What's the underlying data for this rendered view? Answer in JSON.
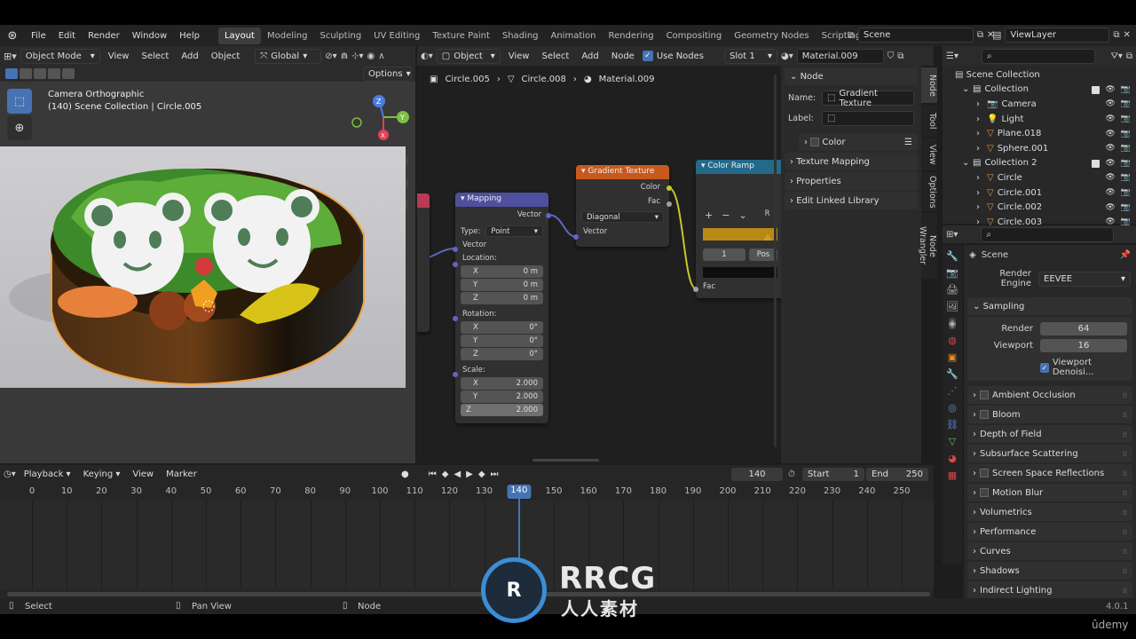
{
  "menubar": {
    "items": [
      "File",
      "Edit",
      "Render",
      "Window",
      "Help"
    ],
    "workspaces": [
      "Layout",
      "Modeling",
      "Sculpting",
      "UV Editing",
      "Texture Paint",
      "Shading",
      "Animation",
      "Rendering",
      "Compositing",
      "Geometry Nodes",
      "Scripting"
    ],
    "scene": "Scene",
    "view_layer": "ViewLayer"
  },
  "viewport": {
    "mode": "Object Mode",
    "menus": [
      "View",
      "Select",
      "Add",
      "Object"
    ],
    "orientation": "Global",
    "options": "Options",
    "cam_title": "Camera Orthographic",
    "cam_sub": "(140) Scene Collection | Circle.005"
  },
  "node_editor": {
    "type": "Object",
    "menus": [
      "View",
      "Select",
      "Add",
      "Node"
    ],
    "use_nodes": "Use Nodes",
    "slot": "Slot 1",
    "material": "Material.009",
    "breadcrumb": [
      "Circle.005",
      "Circle.008",
      "Material.009"
    ],
    "mapping": {
      "title": "Mapping",
      "out_vector": "Vector",
      "type_label": "Type:",
      "type_value": "Point",
      "in_vector": "Vector",
      "location": "Location:",
      "rotation": "Rotation:",
      "scale": "Scale:",
      "loc": [
        {
          "axis": "X",
          "val": "0 m"
        },
        {
          "axis": "Y",
          "val": "0 m"
        },
        {
          "axis": "Z",
          "val": "0 m"
        }
      ],
      "rot": [
        {
          "axis": "X",
          "val": "0°"
        },
        {
          "axis": "Y",
          "val": "0°"
        },
        {
          "axis": "Z",
          "val": "0°"
        }
      ],
      "scl": [
        {
          "axis": "X",
          "val": "2.000"
        },
        {
          "axis": "Y",
          "val": "2.000"
        },
        {
          "axis": "Z",
          "val": "2.000"
        }
      ]
    },
    "gradient": {
      "title": "Gradient Texture",
      "color": "Color",
      "fac": "Fac",
      "type": "Diagonal",
      "vector": "Vector"
    },
    "ramp": {
      "title": "Color Ramp",
      "index": "1",
      "pos": "Pos",
      "fac": "Fac",
      "r": "R"
    }
  },
  "sidebar": {
    "node": "Node",
    "name_label": "Name:",
    "name_value": "Gradient Texture",
    "label_label": "Label:",
    "color": "Color",
    "sections": [
      "Texture Mapping",
      "Properties",
      "Edit Linked Library"
    ],
    "tabs": [
      "Node",
      "Tool",
      "View",
      "Options",
      "Node Wrangler"
    ]
  },
  "outliner": {
    "root": "Scene Collection",
    "rows": [
      {
        "label": "Collection",
        "indent": 1
      },
      {
        "label": "Camera",
        "indent": 2
      },
      {
        "label": "Light",
        "indent": 2
      },
      {
        "label": "Plane.018",
        "indent": 2
      },
      {
        "label": "Sphere.001",
        "indent": 2
      },
      {
        "label": "Collection 2",
        "indent": 1
      },
      {
        "label": "Circle",
        "indent": 2
      },
      {
        "label": "Circle.001",
        "indent": 2
      },
      {
        "label": "Circle.002",
        "indent": 2
      },
      {
        "label": "Circle.003",
        "indent": 2
      }
    ]
  },
  "properties": {
    "scene": "Scene",
    "engine_label": "Render Engine",
    "engine": "EEVEE",
    "sampling": "Sampling",
    "render_label": "Render",
    "render_val": "64",
    "viewport_label": "Viewport",
    "viewport_val": "16",
    "denoise": "Viewport Denoisi...",
    "sections": [
      "Ambient Occlusion",
      "Bloom",
      "Depth of Field",
      "Subsurface Scattering",
      "Screen Space Reflections",
      "Motion Blur",
      "Volumetrics",
      "Performance",
      "Curves",
      "Shadows",
      "Indirect Lighting"
    ]
  },
  "timeline": {
    "menus": [
      "Playback",
      "Keying",
      "View",
      "Marker"
    ],
    "frame": "140",
    "start_label": "Start",
    "start": "1",
    "end_label": "End",
    "end": "250",
    "ticks": [
      "0",
      "10",
      "20",
      "30",
      "40",
      "50",
      "60",
      "70",
      "80",
      "90",
      "100",
      "110",
      "120",
      "130",
      "140",
      "150",
      "160",
      "170",
      "180",
      "190",
      "200",
      "210",
      "220",
      "230",
      "240",
      "250"
    ],
    "current": 140
  },
  "status": {
    "select": "Select",
    "pan": "Pan View",
    "node": "Node",
    "version": "4.0.1"
  },
  "watermark": {
    "main": "RRCG",
    "sub": "人人素材",
    "brand": "ûdemy"
  }
}
